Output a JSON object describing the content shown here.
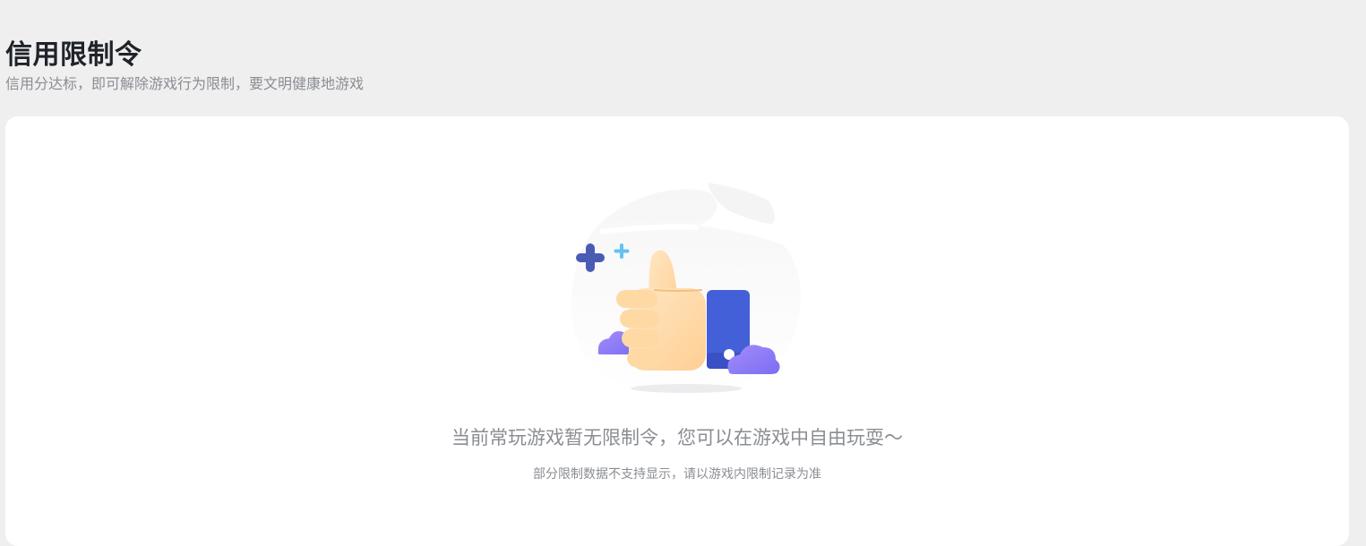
{
  "header": {
    "title": "信用限制令",
    "subtitle": "信用分达标，即可解除游戏行为限制，要文明健康地游戏"
  },
  "empty_state": {
    "illustration_icon": "thumbs-up-illustration",
    "message": "当前常玩游戏暂无限制令，您可以在游戏中自由玩耍～",
    "hint": "部分限制数据不支持显示，请以游戏内限制记录为准"
  },
  "colors": {
    "background": "#efefef",
    "card": "#ffffff",
    "title": "#1f2329",
    "muted_text": "#8a8d93",
    "cuff_blue": "#4460d8",
    "cloud_purple": "#8b7cf6",
    "hand_peach": "#ffdcae"
  }
}
